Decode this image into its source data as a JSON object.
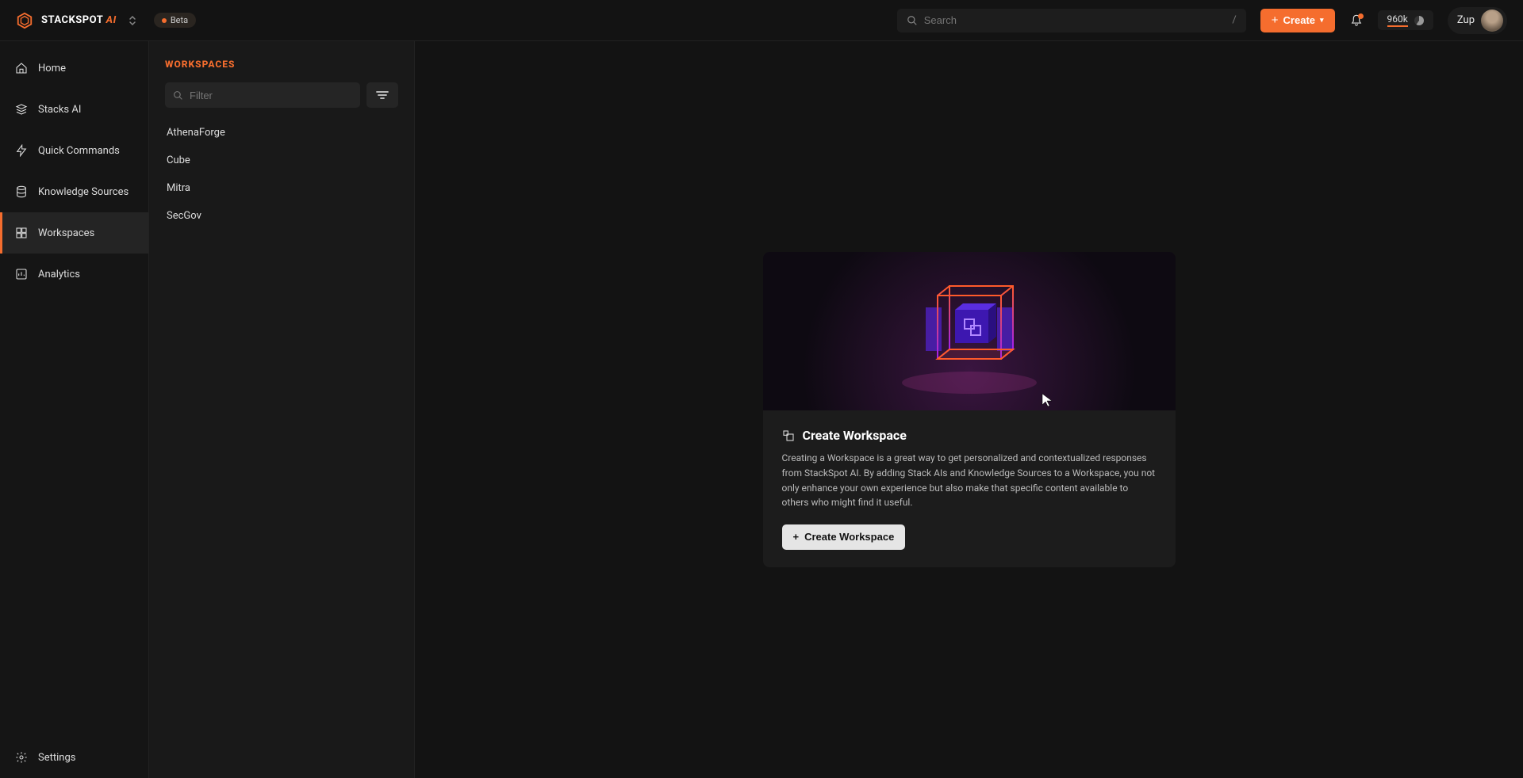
{
  "brand": {
    "name": "STACKSPOT",
    "suffix": "AI",
    "badge": "Beta"
  },
  "header": {
    "search_placeholder": "Search",
    "search_shortcut": "/",
    "create_label": "Create",
    "tokens": "960k",
    "user_label": "Zup"
  },
  "nav": {
    "items": [
      {
        "label": "Home"
      },
      {
        "label": "Stacks AI"
      },
      {
        "label": "Quick Commands"
      },
      {
        "label": "Knowledge Sources"
      },
      {
        "label": "Workspaces"
      },
      {
        "label": "Analytics"
      }
    ],
    "footer": {
      "label": "Settings"
    }
  },
  "list": {
    "title": "WORKSPACES",
    "filter_placeholder": "Filter",
    "items": [
      {
        "label": "AthenaForge"
      },
      {
        "label": "Cube"
      },
      {
        "label": "Mitra"
      },
      {
        "label": "SecGov"
      }
    ]
  },
  "empty": {
    "title": "Create Workspace",
    "description": "Creating a Workspace is a great way to get personalized and contextualized responses from StackSpot AI. By adding Stack AIs and Knowledge Sources to a Workspace, you not only enhance your own experience but also make that specific content available to others who might find it useful.",
    "button": "Create Workspace"
  }
}
